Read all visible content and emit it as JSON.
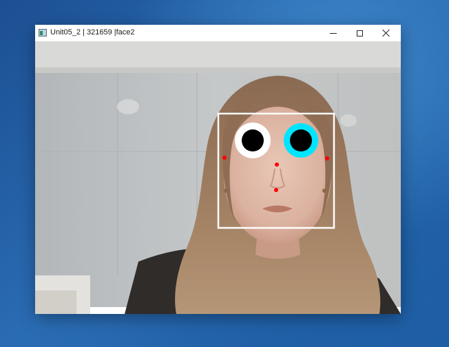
{
  "window": {
    "title": "Unit05_2 | 321659 |face2",
    "controls": [
      "minimize-icon",
      "maximize-icon",
      "close-icon"
    ]
  },
  "colors": {
    "desktop": "#2a6cb4",
    "face_box": "#ffffff",
    "left_eye_ring": "#ffffff",
    "right_eye_ring": "#00e5ff",
    "pupil": "#000000",
    "landmark": "#ff0000"
  }
}
